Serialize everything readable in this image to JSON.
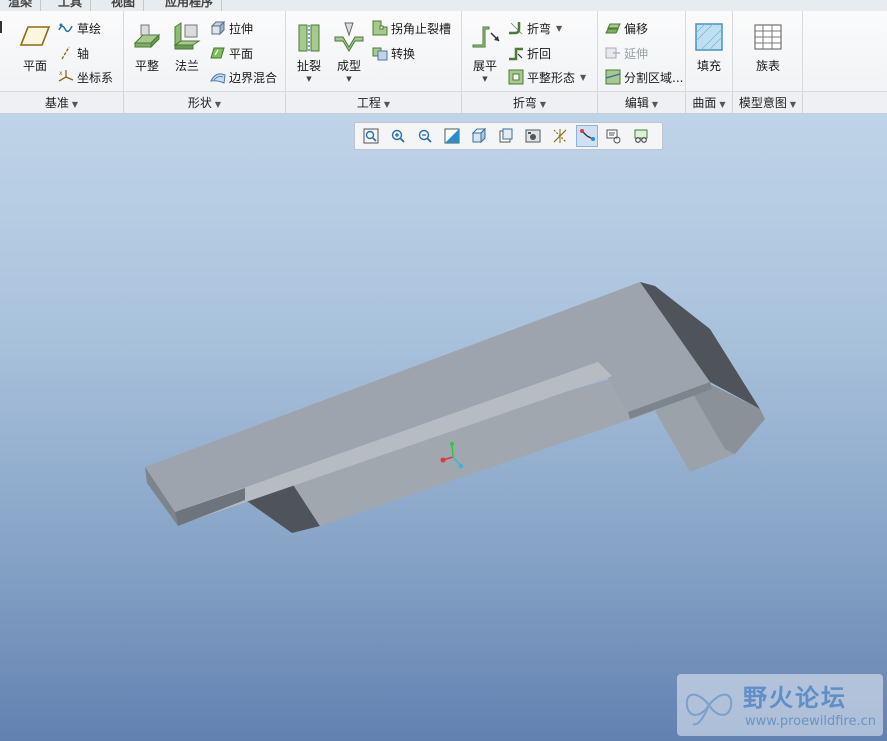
{
  "tabs": [
    {
      "label": "渲染"
    },
    {
      "label": "工具"
    },
    {
      "label": "视图"
    },
    {
      "label": "应用程序"
    }
  ],
  "ribbon": {
    "datum": {
      "group_label": "基准",
      "plane": "平面",
      "sketch": "草绘",
      "axis": "轴",
      "csys": "坐标系"
    },
    "shape": {
      "group_label": "形状",
      "flat": "平整",
      "flange": "法兰",
      "extrude": "拉伸",
      "planar": "平面",
      "blend": "边界混合"
    },
    "engineering": {
      "group_label": "工程",
      "rip": "扯裂",
      "form": "成型",
      "corner_relief": "拐角止裂槽",
      "convert": "转换"
    },
    "bends": {
      "group_label": "折弯",
      "unbend": "展平",
      "bend": "折弯",
      "bend_back": "折回",
      "flat_state": "平整形态"
    },
    "editing": {
      "group_label": "编辑",
      "offset": "偏移",
      "extend": "延伸",
      "split_area": "分割区域..."
    },
    "surfaces": {
      "group_label": "曲面",
      "fill": "填充"
    },
    "model_intent": {
      "group_label": "模型意图",
      "family_table": "族表"
    }
  },
  "graphics_toolbar": {
    "buttons": [
      "refit-icon",
      "zoom-in-icon",
      "zoom-out-icon",
      "repaint-icon",
      "display-style-icon",
      "saved-views-icon",
      "view-manager-icon",
      "datum-display-icon",
      "spin-center-icon",
      "annotation-display-icon",
      "perspective-icon"
    ]
  },
  "watermark": {
    "title": "野火论坛",
    "url": "www.proewildfire.cn"
  },
  "colors": {
    "viewport_top": "#c0d4e8",
    "viewport_bottom": "#6281b0",
    "part_face_light": "#9ea4ad",
    "part_face_dark": "#4f535a"
  }
}
